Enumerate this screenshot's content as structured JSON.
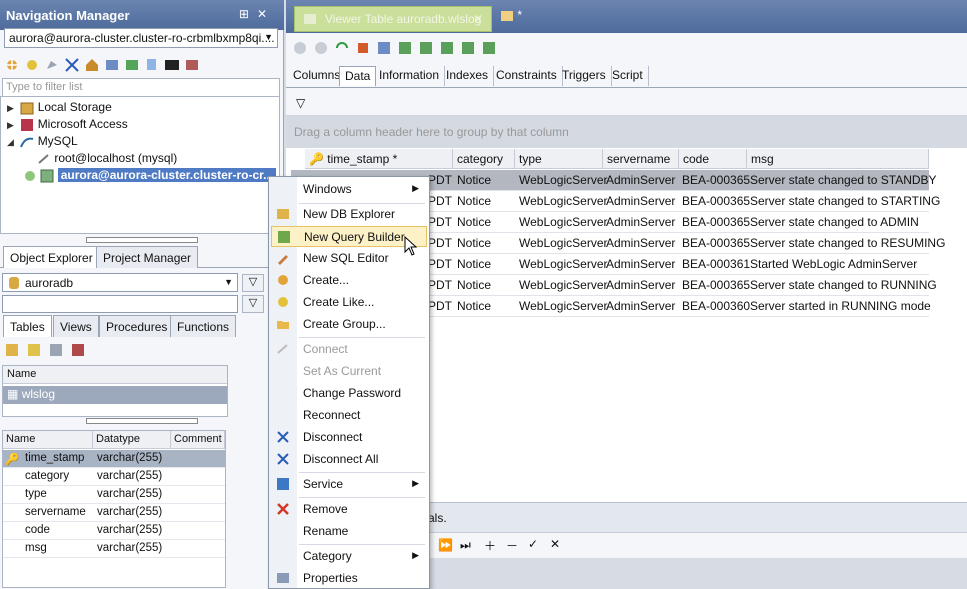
{
  "nav_panel": {
    "title": "Navigation Manager",
    "connection": "aurora@aurora-cluster.cluster-ro-crbmlbxmp8qi....",
    "filter_placeholder": "Type to filter list",
    "tree": [
      {
        "label": "Local Storage",
        "icon": "database-icon"
      },
      {
        "label": "Microsoft Access",
        "icon": "access-icon"
      },
      {
        "label": "MySQL",
        "icon": "mysql-icon"
      },
      {
        "label": "root@localhost (mysql)",
        "icon": "connection-icon"
      },
      {
        "label": "aurora@aurora-cluster.cluster-ro-cr...",
        "icon": "connection-icon"
      }
    ]
  },
  "panel_tabs": [
    "Object Explorer",
    "Project Manager"
  ],
  "database_select": "auroradb",
  "object_tabs": [
    "Tables",
    "Views",
    "Procedures",
    "Functions"
  ],
  "object_grid": {
    "header": "Name",
    "rows": [
      "wlslog"
    ]
  },
  "column_grid": {
    "headers": [
      "Name",
      "Datatype",
      "Comment"
    ],
    "rows": [
      {
        "name": "time_stamp",
        "type": "varchar(255)"
      },
      {
        "name": "category",
        "type": "varchar(255)"
      },
      {
        "name": "type",
        "type": "varchar(255)"
      },
      {
        "name": "servername",
        "type": "varchar(255)"
      },
      {
        "name": "code",
        "type": "varchar(255)"
      },
      {
        "name": "msg",
        "type": "varchar(255)"
      }
    ]
  },
  "doc_tabs": {
    "tab1": "Viewer Table auroradb.wlslog",
    "tab2": "*"
  },
  "sub_tabs": [
    "Columns",
    "Data",
    "Information",
    "Indexes",
    "Constraints",
    "Triggers",
    "Script"
  ],
  "group_hint": "Drag a column header here to group by that column",
  "data_grid": {
    "headers": [
      "time_stamp *",
      "category",
      "type",
      "servername",
      "code",
      "msg"
    ],
    "rows": [
      {
        "ts": "PDT",
        "category": "Notice",
        "type": "WebLogicServer",
        "server": "AdminServer",
        "code": "BEA-000365",
        "msg": "Server state changed to STANDBY"
      },
      {
        "ts": "PDT",
        "category": "Notice",
        "type": "WebLogicServer",
        "server": "AdminServer",
        "code": "BEA-000365",
        "msg": "Server state changed to STARTING"
      },
      {
        "ts": "PDT",
        "category": "Notice",
        "type": "WebLogicServer",
        "server": "AdminServer",
        "code": "BEA-000365",
        "msg": "Server state changed to ADMIN"
      },
      {
        "ts": "PDT",
        "category": "Notice",
        "type": "WebLogicServer",
        "server": "AdminServer",
        "code": "BEA-000365",
        "msg": "Server state changed to RESUMING"
      },
      {
        "ts": "PDT",
        "category": "Notice",
        "type": "WebLogicServer",
        "server": "AdminServer",
        "code": "BEA-000361",
        "msg": "Started WebLogic AdminServer"
      },
      {
        "ts": "PDT",
        "category": "Notice",
        "type": "WebLogicServer",
        "server": "AdminServer",
        "code": "BEA-000365",
        "msg": "Server state changed to RUNNING"
      },
      {
        "ts": "PDT",
        "category": "Notice",
        "type": "WebLogicServer",
        "server": "AdminServer",
        "code": "BEA-000360",
        "msg": "Server started in RUNNING mode"
      }
    ]
  },
  "status_text": "als.",
  "context_menu": [
    {
      "label": "Windows",
      "submenu": true
    },
    {
      "label": "New DB Explorer"
    },
    {
      "label": "New Query Builder",
      "hover": true
    },
    {
      "label": "New SQL Editor"
    },
    {
      "label": "Create..."
    },
    {
      "label": "Create Like..."
    },
    {
      "label": "Create Group..."
    },
    {
      "label": "Connect",
      "disabled": true
    },
    {
      "label": "Set As Current",
      "disabled": true
    },
    {
      "label": "Change Password"
    },
    {
      "label": "Reconnect"
    },
    {
      "label": "Disconnect"
    },
    {
      "label": "Disconnect All"
    },
    {
      "label": "Service",
      "submenu": true
    },
    {
      "label": "Remove"
    },
    {
      "label": "Rename"
    },
    {
      "label": "Category",
      "submenu": true
    },
    {
      "label": "Properties"
    }
  ],
  "colors": {
    "title_bar": "#4e6b9c",
    "selection": "#4f7bc4",
    "active_doc_tab": "#c9df9a",
    "menu_hover": "#fdf2c7"
  }
}
